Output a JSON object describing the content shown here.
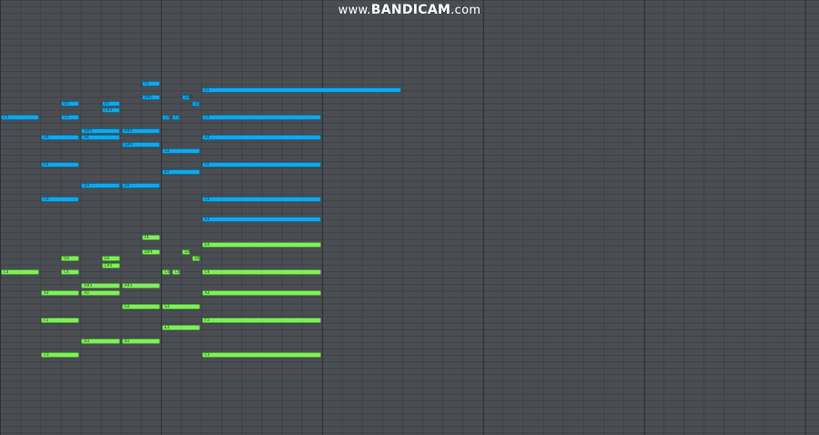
{
  "watermark": {
    "prefix": "www.",
    "brand": "BANDICAM",
    "suffix": ".com"
  },
  "colors": {
    "background": "#4a4d52",
    "blue_notes": "#13a6ea",
    "green_notes": "#7ef05a"
  },
  "notes": {
    "blue": [
      {
        "label": "F5",
        "start": 7,
        "length": 1
      },
      {
        "label": "E5",
        "start": 10,
        "length": 10
      },
      {
        "label": "D5",
        "start": 3,
        "length": 1
      },
      {
        "label": "D5",
        "start": 5,
        "length": 1
      },
      {
        "label": "D5",
        "start": 9.5,
        "length": 0.5
      },
      {
        "label": "D#5",
        "start": 7,
        "length": 1
      },
      {
        "label": "D#5",
        "start": 9,
        "length": 0.5
      },
      {
        "label": "C#5",
        "start": 5,
        "length": 1
      },
      {
        "label": "C5",
        "start": 0,
        "length": 2
      },
      {
        "label": "C5",
        "start": 3,
        "length": 1
      },
      {
        "label": "C5",
        "start": 8,
        "length": 0.5
      },
      {
        "label": "C5",
        "start": 8.5,
        "length": 0.5
      },
      {
        "label": "C5",
        "start": 10,
        "length": 6
      },
      {
        "label": "A#4",
        "start": 6,
        "length": 2
      },
      {
        "label": "A4",
        "start": 2,
        "length": 2
      },
      {
        "label": "A4",
        "start": 4,
        "length": 2
      },
      {
        "label": "A4",
        "start": 10,
        "length": 6
      },
      {
        "label": "G#4",
        "start": 6,
        "length": 2
      },
      {
        "label": "G4",
        "start": 8,
        "length": 2
      },
      {
        "label": "A#4",
        "start": 4,
        "length": 2
      },
      {
        "label": "F4",
        "start": 2,
        "length": 2
      },
      {
        "label": "F4",
        "start": 10,
        "length": 6
      },
      {
        "label": "E4",
        "start": 8,
        "length": 2
      },
      {
        "label": "D4",
        "start": 4,
        "length": 2
      },
      {
        "label": "D4",
        "start": 6,
        "length": 2
      },
      {
        "label": "C4",
        "start": 2,
        "length": 2
      },
      {
        "label": "C4",
        "start": 10,
        "length": 6
      },
      {
        "label": "A3",
        "start": 10,
        "length": 6
      }
    ],
    "green": [
      {
        "label": "F4",
        "start": 7,
        "length": 1
      },
      {
        "label": "E4",
        "start": 10,
        "length": 6
      },
      {
        "label": "D4",
        "start": 3,
        "length": 1
      },
      {
        "label": "D4",
        "start": 5,
        "length": 1
      },
      {
        "label": "D4",
        "start": 9.5,
        "length": 0.5
      },
      {
        "label": "D#4",
        "start": 7,
        "length": 1
      },
      {
        "label": "D#4",
        "start": 9,
        "length": 0.5
      },
      {
        "label": "C#4",
        "start": 5,
        "length": 1
      },
      {
        "label": "C4",
        "start": 0,
        "length": 2
      },
      {
        "label": "C4",
        "start": 3,
        "length": 1
      },
      {
        "label": "C4",
        "start": 8,
        "length": 0.5
      },
      {
        "label": "C4",
        "start": 8.5,
        "length": 0.5
      },
      {
        "label": "C4",
        "start": 10,
        "length": 6
      },
      {
        "label": "A#3",
        "start": 6,
        "length": 2
      },
      {
        "label": "A3",
        "start": 2,
        "length": 2
      },
      {
        "label": "A3",
        "start": 4,
        "length": 2
      },
      {
        "label": "A3",
        "start": 10,
        "length": 6
      },
      {
        "label": "G3",
        "start": 6,
        "length": 2
      },
      {
        "label": "G3",
        "start": 8,
        "length": 2
      },
      {
        "label": "A#3",
        "start": 4,
        "length": 2
      },
      {
        "label": "F3",
        "start": 2,
        "length": 2
      },
      {
        "label": "F3",
        "start": 10,
        "length": 6
      },
      {
        "label": "E3",
        "start": 8,
        "length": 2
      },
      {
        "label": "D3",
        "start": 4,
        "length": 2
      },
      {
        "label": "D3",
        "start": 6,
        "length": 2
      },
      {
        "label": "C3",
        "start": 2,
        "length": 2
      },
      {
        "label": "C3",
        "start": 10,
        "length": 6
      }
    ]
  }
}
